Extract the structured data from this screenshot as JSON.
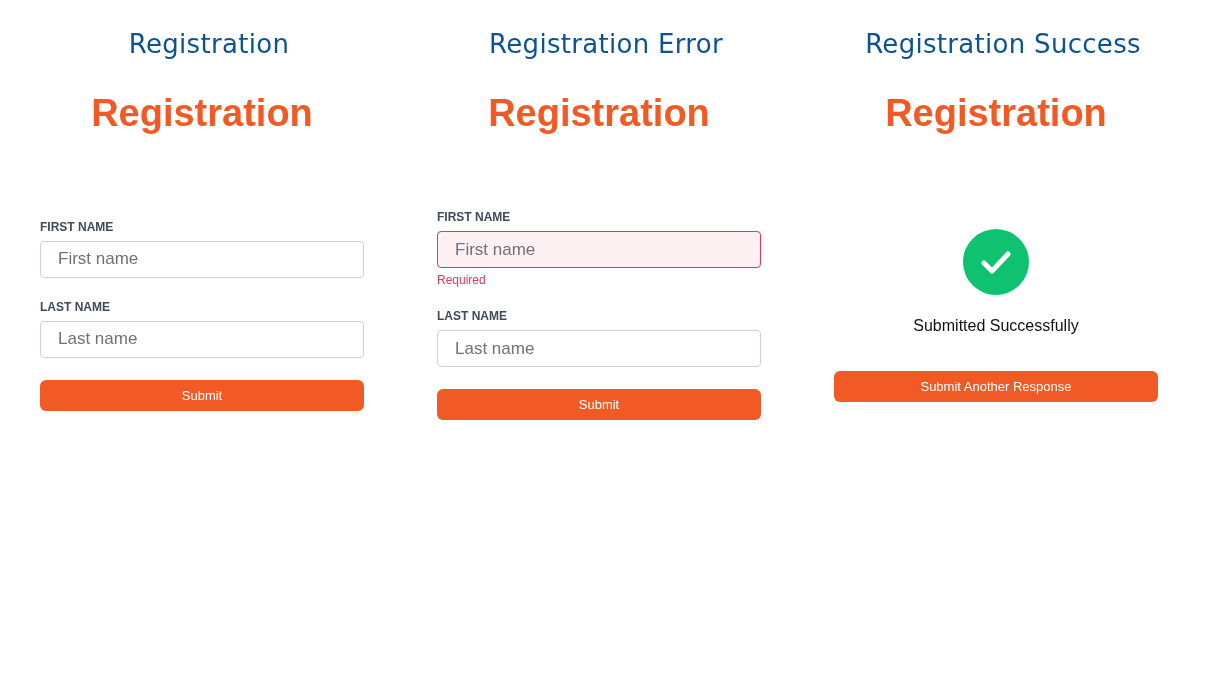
{
  "panels": [
    {
      "kind": "form",
      "caption": "Registration",
      "title": "Registration",
      "fields": [
        {
          "label": "FIRST NAME",
          "placeholder": "First name",
          "error": false
        },
        {
          "label": "LAST NAME",
          "placeholder": "Last name",
          "error": false
        }
      ],
      "button": "Submit"
    },
    {
      "kind": "form",
      "caption": "Registration Error",
      "title": "Registration",
      "fields": [
        {
          "label": "FIRST NAME",
          "placeholder": "First name",
          "error": true,
          "message": "Required"
        },
        {
          "label": "LAST NAME",
          "placeholder": "Last name",
          "error": false
        }
      ],
      "button": "Submit"
    },
    {
      "kind": "success",
      "caption": "Registration Success",
      "title": "Registration",
      "message": "Submitted Successfully",
      "button": "Submit Another Response"
    }
  ]
}
